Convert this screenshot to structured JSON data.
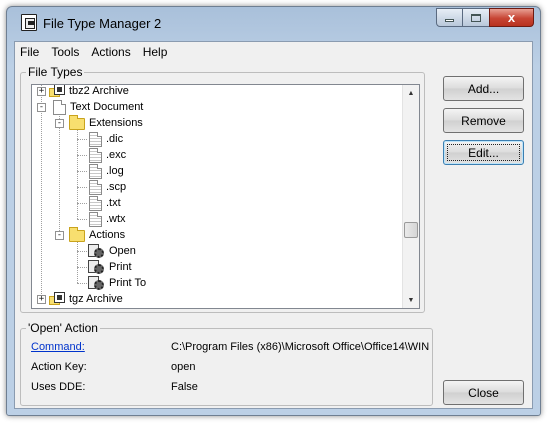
{
  "window": {
    "title": "File Type Manager 2",
    "caption_buttons": {
      "minimize": "—",
      "maximize": "□",
      "close": "x"
    }
  },
  "menu": [
    "File",
    "Tools",
    "Actions",
    "Help"
  ],
  "file_types": {
    "legend": "File Types",
    "tree": [
      {
        "label": "tbz2 Archive",
        "icon": "archive-icon",
        "expander": "+"
      },
      {
        "label": "Text Document",
        "icon": "document-icon",
        "expander": "-"
      },
      {
        "label": "Extensions",
        "icon": "folder-icon",
        "expander": "-"
      },
      {
        "label": ".dic",
        "icon": "file-icon"
      },
      {
        "label": ".exc",
        "icon": "file-icon"
      },
      {
        "label": ".log",
        "icon": "file-icon"
      },
      {
        "label": ".scp",
        "icon": "file-icon"
      },
      {
        "label": ".txt",
        "icon": "file-icon"
      },
      {
        "label": ".wtx",
        "icon": "file-icon"
      },
      {
        "label": "Actions",
        "icon": "folder-icon",
        "expander": "-"
      },
      {
        "label": "Open",
        "icon": "action-icon"
      },
      {
        "label": "Print",
        "icon": "action-icon"
      },
      {
        "label": "Print To",
        "icon": "action-icon"
      },
      {
        "label": "tgz Archive",
        "icon": "archive-icon",
        "expander": "+"
      }
    ],
    "scroll_position": 0.6
  },
  "buttons": {
    "add": "Add...",
    "remove": "Remove",
    "edit": "Edit...",
    "close": "Close"
  },
  "action": {
    "legend": "'Open' Action",
    "command_label": "Command:",
    "command_value": "C:\\Program Files (x86)\\Microsoft Office\\Office14\\WIN",
    "action_key_label": "Action Key:",
    "action_key_value": "open",
    "uses_dde_label": "Uses DDE:",
    "uses_dde_value": "False"
  },
  "colors": {
    "link": "#0033cc",
    "close_button": "#c74534",
    "frame": "#bcd0e6"
  }
}
